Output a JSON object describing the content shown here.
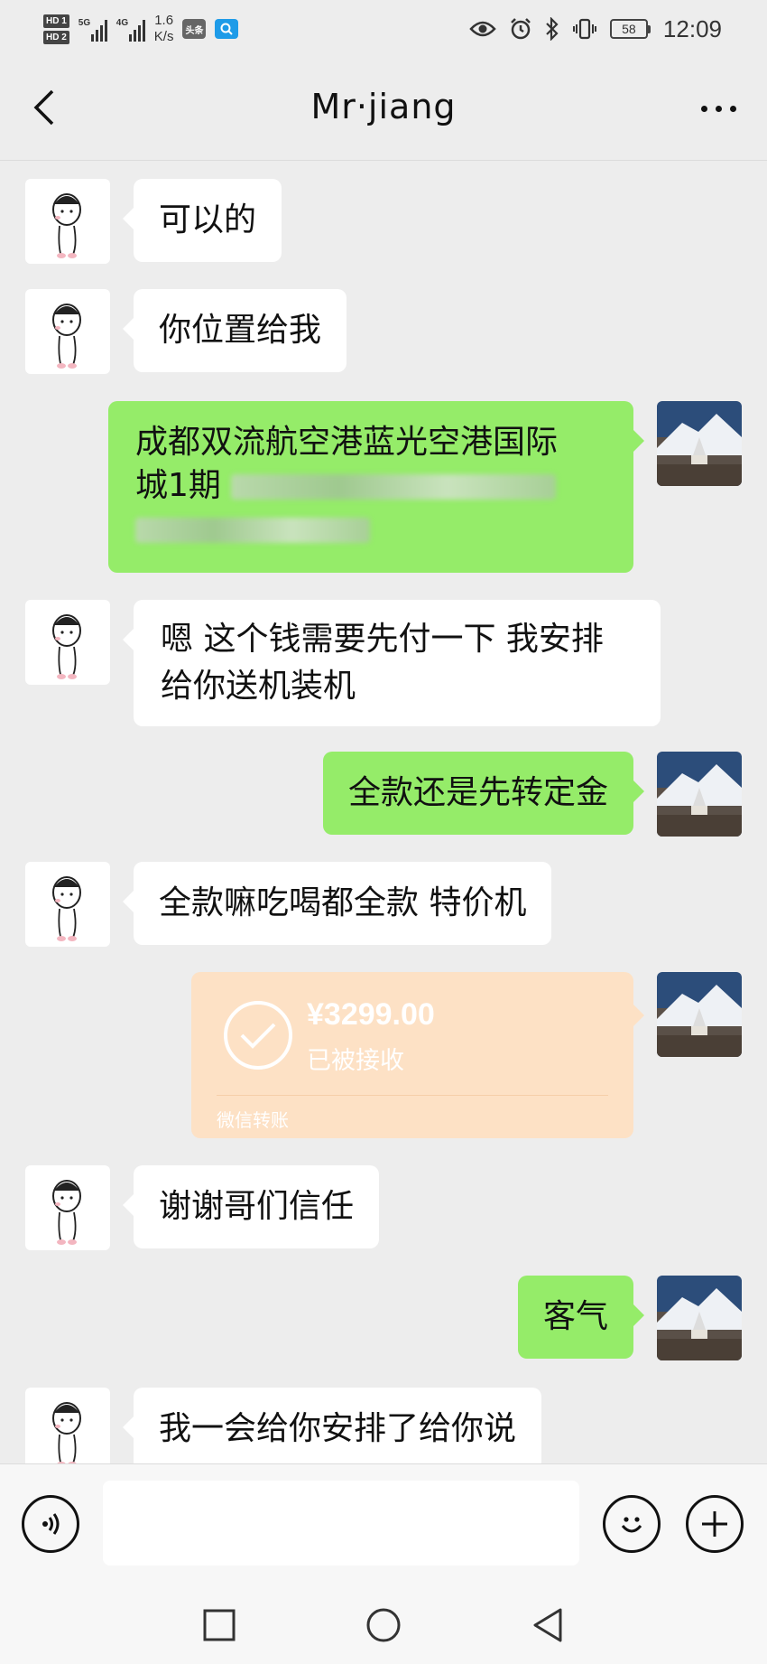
{
  "status_bar": {
    "sim1": "HD 1",
    "sim2": "HD 2",
    "network1": "5G",
    "network2": "4G",
    "speed_value": "1.6",
    "speed_unit": "K/s",
    "app_badge_1": "头条",
    "battery": "58",
    "time": "12:09",
    "icons": [
      "eye-icon",
      "alarm-icon",
      "bluetooth-icon",
      "vibrate-icon",
      "battery-icon"
    ]
  },
  "header": {
    "title": "Mr·jiang",
    "back_icon": "chevron-left-icon",
    "more_icon": "more-icon"
  },
  "messages": [
    {
      "side": "in",
      "text": "可以的"
    },
    {
      "side": "in",
      "text": "你位置给我"
    },
    {
      "side": "out",
      "text_line1": "成都双流航空港蓝光空港国际",
      "text_line2_visible": "城1期",
      "redacted": true
    },
    {
      "side": "in",
      "text_line1": "嗯 这个钱需要先付一下 我安排",
      "text_line2": "给你送机装机"
    },
    {
      "side": "out",
      "text": "全款还是先转定金"
    },
    {
      "side": "in",
      "text": "全款嘛吃喝都全款 特价机"
    },
    {
      "side": "out",
      "type": "transfer",
      "amount": "¥3299.00",
      "status": "已被接收",
      "label": "微信转账"
    },
    {
      "side": "in",
      "text": "谢谢哥们信任"
    },
    {
      "side": "out",
      "text": "客气"
    },
    {
      "side": "in",
      "text": "我一会给你安排了给你说"
    }
  ],
  "input_bar": {
    "voice_icon": "voice-icon",
    "emoji_icon": "emoji-icon",
    "plus_icon": "plus-icon",
    "placeholder": ""
  },
  "nav": {
    "icons": [
      "recent-apps-icon",
      "home-icon",
      "back-triangle-icon"
    ]
  },
  "colors": {
    "background": "#ededed",
    "bubble_out": "#95ec69",
    "bubble_in": "#ffffff",
    "transfer": "#fde1c5"
  }
}
